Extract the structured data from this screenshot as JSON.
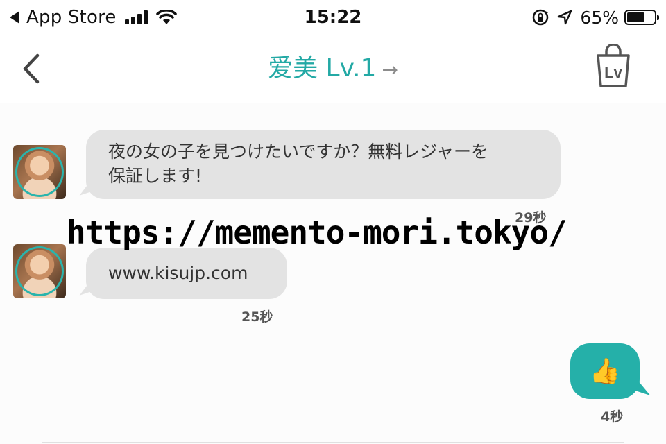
{
  "status_bar": {
    "back_app": "App Store",
    "time": "15:22",
    "battery_pct": "65%",
    "battery_level": 0.65,
    "icons": [
      "signal-icon",
      "wifi-icon",
      "rotation-lock-icon",
      "location-icon",
      "battery-icon"
    ]
  },
  "nav": {
    "title": "爱美 Lv.1",
    "title_arrow": "→",
    "back_icon": "chevron-left-icon",
    "shop_icon": "level-shop-bag-icon",
    "shop_icon_text": "Lv",
    "accent_color": "#23a9a5"
  },
  "messages": [
    {
      "sender": "other",
      "line1": "夜の女の子を見つけたいですか？無料レジャーを",
      "line2": "保証します!",
      "time": "29秒"
    },
    {
      "sender": "other",
      "text": "www.kisujp.com",
      "time": "25秒"
    },
    {
      "sender": "me",
      "emoji": "👍",
      "time": "4秒"
    }
  ],
  "watermark": "https://memento-mori.tokyo/",
  "colors": {
    "incoming_bubble": "#e3e3e3",
    "outgoing_bubble": "#25b0a9"
  }
}
